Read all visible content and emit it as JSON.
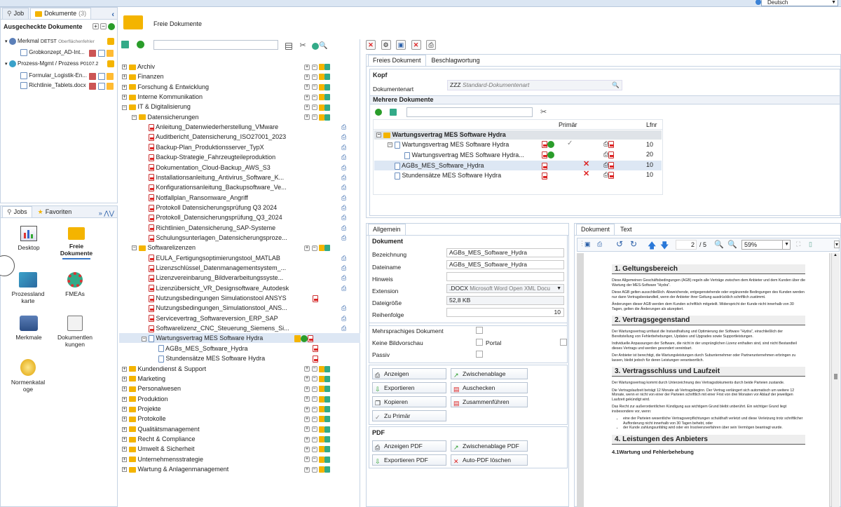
{
  "language": "Deutsch",
  "left_top": {
    "tab_job": "Job",
    "tab_dokumente": "Dokumente",
    "tab_dokumente_count": "(3)",
    "section_title": "Ausgecheckte Dokumente",
    "items": [
      {
        "label": "Merkmal",
        "code": "DETST",
        "sub": "Oberflächenfehler"
      },
      {
        "label": "Grobkonzept_AD-Int..."
      },
      {
        "label": "Prozess-Mgmt / Prozess",
        "code": "P0107.2"
      },
      {
        "label": "Formular_Logistik-En..."
      },
      {
        "label": "Richtlinie_Tablets.docx"
      }
    ]
  },
  "left_bottom": {
    "tab_jobs": "Jobs",
    "tab_favoriten": "Favoriten",
    "apps": [
      {
        "label": "Desktop"
      },
      {
        "label": "Freie Dokumente"
      },
      {
        "label": "Prozesslandkarte"
      },
      {
        "label": "FMEAs"
      },
      {
        "label": "Merkmale"
      },
      {
        "label": "Dokumentlenkungen"
      },
      {
        "label": "Normenkataloge"
      }
    ]
  },
  "header": {
    "title": "Freie Dokumente"
  },
  "tree": {
    "items": [
      {
        "label": "Archiv",
        "level": 0,
        "type": "folder",
        "exp": "+"
      },
      {
        "label": "Finanzen",
        "level": 0,
        "type": "folder",
        "exp": "+"
      },
      {
        "label": "Forschung & Entwicklung",
        "level": 0,
        "type": "folder",
        "exp": "+"
      },
      {
        "label": "Interne Kommunikation",
        "level": 0,
        "type": "folder",
        "exp": "+"
      },
      {
        "label": "IT & Digitalisierung",
        "level": 0,
        "type": "folder",
        "exp": "−"
      },
      {
        "label": "Datensicherungen",
        "level": 1,
        "type": "folder",
        "exp": "−"
      },
      {
        "label": "Anleitung_Datenwiederherstellung_VMware",
        "level": 2,
        "type": "pdf"
      },
      {
        "label": "Auditbericht_Datensicherung_ISO27001_2023",
        "level": 2,
        "type": "pdf"
      },
      {
        "label": "Backup-Plan_Produktionsserver_TypX",
        "level": 2,
        "type": "pdf"
      },
      {
        "label": "Backup-Strategie_Fahrzeugteileproduktion",
        "level": 2,
        "type": "pdf"
      },
      {
        "label": "Dokumentation_Cloud-Backup_AWS_S3",
        "level": 2,
        "type": "pdf"
      },
      {
        "label": "Installationsanleitung_Antivirus_Software_K...",
        "level": 2,
        "type": "pdf"
      },
      {
        "label": "Konfigurationsanleitung_Backupsoftware_Ve...",
        "level": 2,
        "type": "pdf"
      },
      {
        "label": "Notfallplan_Ransomware_Angriff",
        "level": 2,
        "type": "pdf"
      },
      {
        "label": "Protokoll Datensicherungsprüfung Q3 2024",
        "level": 2,
        "type": "pdf"
      },
      {
        "label": "Protokoll_Datensicherungsprüfung_Q3_2024",
        "level": 2,
        "type": "pdf"
      },
      {
        "label": "Richtlinien_Datensicherung_SAP-Systeme",
        "level": 2,
        "type": "pdf"
      },
      {
        "label": "Schulungsunterlagen_Datensicherungsproze...",
        "level": 2,
        "type": "pdf"
      },
      {
        "label": "Softwarelizenzen",
        "level": 1,
        "type": "folder",
        "exp": "−"
      },
      {
        "label": "EULA_Fertigungsoptimierungstool_MATLAB",
        "level": 2,
        "type": "pdf"
      },
      {
        "label": "Lizenzschlüssel_Datenmanagementsystem_...",
        "level": 2,
        "type": "pdf"
      },
      {
        "label": "Lizenzvereinbarung_Bildverarbeitungssyste...",
        "level": 2,
        "type": "pdf"
      },
      {
        "label": "Lizenzübersicht_VR_Designsoftware_Autodesk",
        "level": 2,
        "type": "pdf"
      },
      {
        "label": "Nutzungsbedingungen Simulationstool ANSYS",
        "level": 2,
        "type": "pdf"
      },
      {
        "label": "Nutzungsbedingungen_Simulationstool_ANS...",
        "level": 2,
        "type": "pdf"
      },
      {
        "label": "Servicevertrag_Softwareversion_ERP_SAP",
        "level": 2,
        "type": "pdf"
      },
      {
        "label": "Softwarelizenz_CNC_Steuerung_Siemens_Si...",
        "level": 2,
        "type": "pdf"
      },
      {
        "label": "Wartungsvertrag MES Software Hydra",
        "level": 2,
        "type": "doc",
        "exp": "−",
        "selected": true
      },
      {
        "label": "AGBs_MES_Software_Hydra",
        "level": 3,
        "type": "doc"
      },
      {
        "label": "Stundensätze MES Software Hydra",
        "level": 3,
        "type": "doc"
      },
      {
        "label": "Kundendienst & Support",
        "level": 0,
        "type": "folder",
        "exp": "+"
      },
      {
        "label": "Marketing",
        "level": 0,
        "type": "folder",
        "exp": "+"
      },
      {
        "label": "Personalwesen",
        "level": 0,
        "type": "folder",
        "exp": "+"
      },
      {
        "label": "Produktion",
        "level": 0,
        "type": "folder",
        "exp": "+"
      },
      {
        "label": "Projekte",
        "level": 0,
        "type": "folder",
        "exp": "+"
      },
      {
        "label": "Protokolle",
        "level": 0,
        "type": "folder",
        "exp": "+"
      },
      {
        "label": "Qualitätsmanagement",
        "level": 0,
        "type": "folder",
        "exp": "+"
      },
      {
        "label": "Recht & Compliance",
        "level": 0,
        "type": "folder",
        "exp": "+"
      },
      {
        "label": "Umwelt & Sicherheit",
        "level": 0,
        "type": "folder",
        "exp": "+"
      },
      {
        "label": "Unternehmensstrategie",
        "level": 0,
        "type": "folder",
        "exp": "+"
      },
      {
        "label": "Wartung & Anlagenmanagement",
        "level": 0,
        "type": "folder",
        "exp": "+"
      }
    ]
  },
  "detail": {
    "tab_freies": "Freies Dokument",
    "tab_beschlag": "Beschlagwortung",
    "kopf": "Kopf",
    "dokumentenart_label": "Dokumentenart",
    "dokumentenart_code": "ZZZ",
    "dokumentenart_value": "Standard-Dokumentenart",
    "mehrere": "Mehrere Dokumente",
    "col_primaer": "Primär",
    "col_lfnr": "Lfnr",
    "rows": [
      {
        "label": "Wartungsvertrag MES Software Hydra",
        "lfnr": "",
        "group": true
      },
      {
        "label": "Wartungsvertrag MES Software Hydra",
        "lfnr": "10"
      },
      {
        "label": "Wartungsvertrag MES Software Hydra...",
        "lfnr": "20"
      },
      {
        "label": "AGBs_MES_Software_Hydra",
        "lfnr": "10"
      },
      {
        "label": "Stundensätze MES Software Hydra",
        "lfnr": "10"
      }
    ]
  },
  "allgemein": {
    "tab": "Allgemein",
    "section": "Dokument",
    "bezeichnung_label": "Bezeichnung",
    "bezeichnung": "AGBs_MES_Software_Hydra",
    "dateiname_label": "Dateiname",
    "dateiname": "AGBs_MES_Software_Hydra",
    "hinweis_label": "Hinweis",
    "extension_label": "Extension",
    "extension": ".DOCX",
    "extension_desc": "Microsoft Word Open XML Docu",
    "dateigroesse_label": "Dateigröße",
    "dateigroesse": "52,8 KB",
    "reihenfolge_label": "Reihenfolge",
    "reihenfolge": "10",
    "mehrsprachig": "Mehrsprachiges Dokument",
    "keine_bildvorschau": "Keine Bildvorschau",
    "portal": "Portal",
    "passiv": "Passiv",
    "buttons": {
      "anzeigen": "Anzeigen",
      "zwischenablage": "Zwischenablage",
      "exportieren": "Exportieren",
      "auschecken": "Auschecken",
      "kopieren": "Kopieren",
      "zusammenfuehren": "Zusammenführen",
      "zu_primaer": "Zu Primär"
    },
    "pdf_section": "PDF",
    "pdf_buttons": {
      "anzeigen_pdf": "Anzeigen PDF",
      "zwischenablage_pdf": "Zwischenablage PDF",
      "exportieren_pdf": "Exportieren PDF",
      "auto_pdf_loeschen": "Auto-PDF löschen"
    }
  },
  "viewer": {
    "tab_dokument": "Dokument",
    "tab_text": "Text",
    "page": "2",
    "pages": "/ 5",
    "zoom": "59%",
    "s1_title": "1. Geltungsbereich",
    "s1_p1": "Diese Allgemeinen Geschäftsbedingungen (AGB) regeln alle Verträge zwischen dem Anbieter und dem Kunden über die Wartung der MES-Software \"Hydra\".",
    "s1_p2": "Diese AGB gelten ausschließlich. Abweichende, entgegenstehende oder ergänzende Bedingungen des Kunden werden nur dann Vertragsbestandteil, wenn der Anbieter ihrer Geltung ausdrücklich schriftlich zustimmt.",
    "s1_p3": "Änderungen dieser AGB werden dem Kunden schriftlich mitgeteilt. Widerspricht der Kunde nicht innerhalb von 30 Tagen, gelten die Änderungen als akzeptiert.",
    "s2_title": "2. Vertragsgegenstand",
    "s2_p1": "Der Wartungsvertrag umfasst die Instandhaltung und Optimierung der Software \"Hydra\", einschließlich der Bereitstellung von Fehlerbehebungen, Updates und Upgrades sowie Supportleistungen.",
    "s2_p2": "Individuelle Anpassungen der Software, die nicht in der ursprünglichen Lizenz enthalten sind, sind nicht Bestandteil dieses Vertrags und werden gesondert vereinbart.",
    "s2_p3": "Der Anbieter ist berechtigt, die Wartungsleistungen durch Subunternehmer oder Partnerunternehmen erbringen zu lassen, bleibt jedoch für deren Leistungen verantwortlich.",
    "s3_title": "3. Vertragsschluss und Laufzeit",
    "s3_p1": "Der Wartungsvertrag kommt durch Unterzeichnung des Vertragsdokuments durch beide Parteien zustande.",
    "s3_p2": "Die Vertragslaufzeit beträgt 12 Monate ab Vertragsbeginn. Der Vertrag verlängert sich automatisch um weitere 12 Monate, wenn er nicht von einer der Parteien schriftlich mit einer Frist von drei Monaten vor Ablauf der jeweiligen Laufzeit gekündigt wird.",
    "s3_p3": "Das Recht zur außerordentlichen Kündigung aus wichtigem Grund bleibt unberührt. Ein wichtiger Grund liegt insbesondere vor, wenn:",
    "s3_li1": "eine der Parteien wesentliche Vertragsverpflichtungen schuldhaft verletzt und diese Verletzung trotz schriftlicher Aufforderung nicht innerhalb von 30 Tagen behebt, oder",
    "s3_li2": "der Kunde zahlungsunfähig wird oder ein Insolvenzverfahren über sein Vermögen beantragt wurde.",
    "s4_title": "4. Leistungen des Anbieters",
    "s41_title": "4.1Wartung und Fehlerbehebung"
  }
}
